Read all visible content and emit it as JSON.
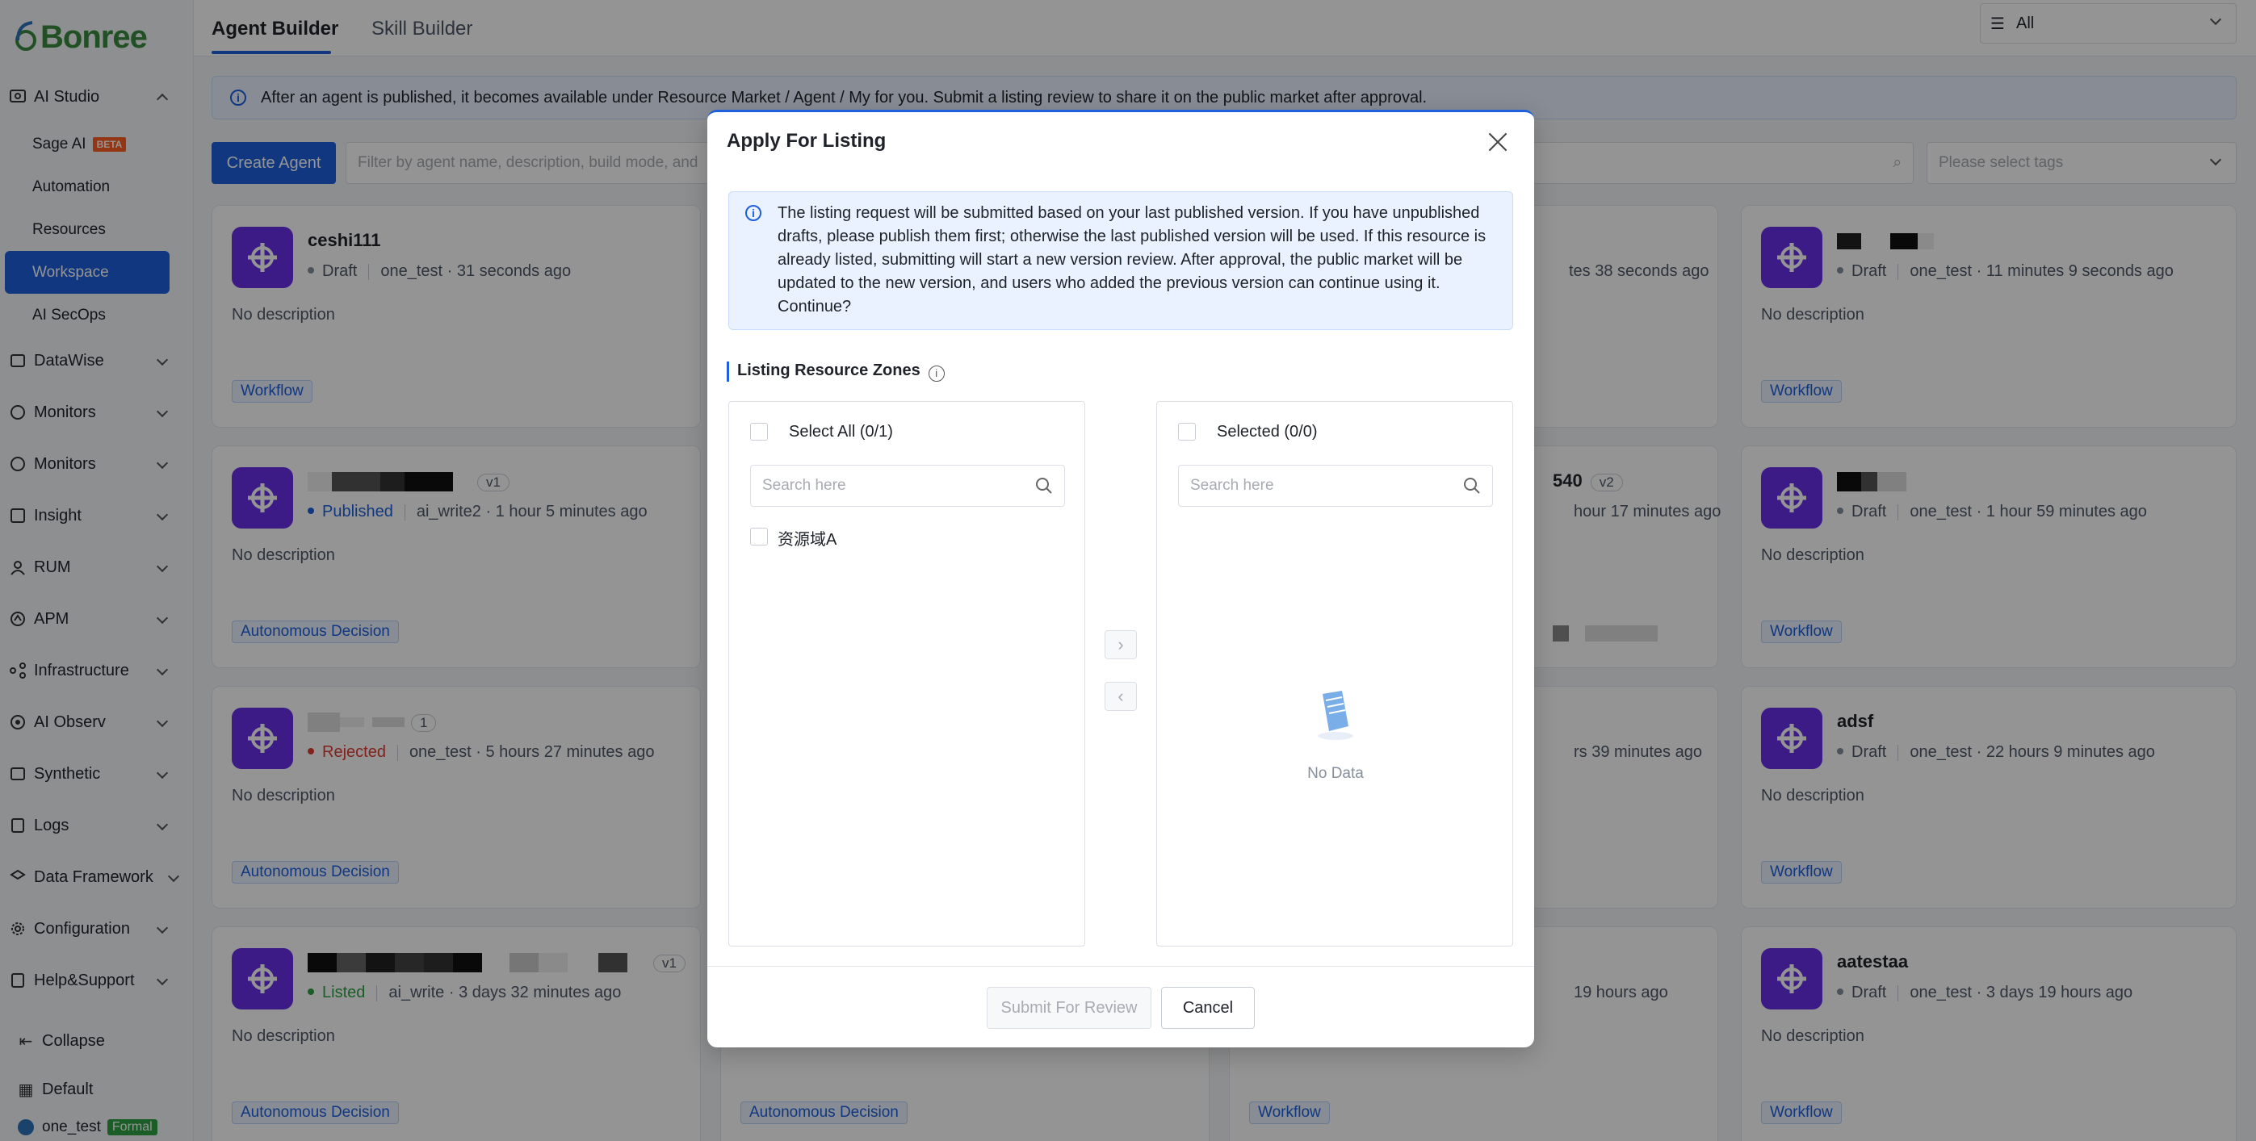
{
  "brand": {
    "name": "Bonree",
    "color": "#3a8a3e"
  },
  "sidebar": {
    "ai_studio": "AI Studio",
    "sub_items": [
      {
        "label": "Sage AI",
        "badge": "BETA"
      },
      {
        "label": "Automation"
      },
      {
        "label": "Resources"
      },
      {
        "label": "Workspace",
        "active": true
      },
      {
        "label": "AI SecOps"
      }
    ],
    "groups": [
      "DataWise",
      "Monitors",
      "Monitors",
      "Insight",
      "RUM",
      "APM",
      "Infrastructure",
      "AI Observ",
      "Synthetic",
      "Logs",
      "Data Framework",
      "Configuration",
      "Help&Support"
    ],
    "collapse": "Collapse",
    "default": "Default",
    "user": {
      "name": "one_test",
      "badge": "Formal"
    }
  },
  "tabs": {
    "agent_builder": "Agent Builder",
    "skill_builder": "Skill Builder"
  },
  "top_select": {
    "value": "All"
  },
  "banner": "After an agent is published, it becomes available under Resource Market / Agent / My for you. Submit a listing review to share it on the public market after approval.",
  "toolbar": {
    "create_label": "Create Agent",
    "filter_placeholder": "Filter by agent name, description, build mode, and",
    "tags_placeholder": "Please select tags"
  },
  "cards": {
    "c1": {
      "name": "ceshi111",
      "status": "Draft",
      "owner": "one_test",
      "time": "31 seconds ago",
      "desc": "No description",
      "tag": "Workflow"
    },
    "c2": {
      "version": "v1",
      "status": "Published",
      "owner": "ai_write2",
      "time": "1 hour 5 minutes ago",
      "desc": "No description",
      "tag": "Autonomous Decision"
    },
    "c3": {
      "version": "1",
      "status": "Rejected",
      "owner": "one_test",
      "time": "5 hours 27 minutes ago",
      "desc": "No description",
      "tag": "Autonomous Decision"
    },
    "c4": {
      "version": "v1",
      "status": "Listed",
      "owner": "ai_write",
      "time": "3 days 32 minutes ago",
      "desc": "No description",
      "tag": "Autonomous Decision"
    },
    "c5": {
      "tag": "Autonomous Decision"
    },
    "c6": {
      "time_partial": "tes 38 seconds ago"
    },
    "c7": {
      "name_partial": "540",
      "version": "v2",
      "time_partial": "hour 17 minutes ago"
    },
    "c8": {
      "time_partial": "rs 39 minutes ago"
    },
    "c9": {
      "time_partial": "19 hours ago",
      "tag": "Workflow"
    },
    "c10": {
      "status": "Draft",
      "owner": "one_test",
      "time": "11 minutes 9 seconds ago",
      "desc": "No description",
      "tag": "Workflow"
    },
    "c11": {
      "status": "Draft",
      "owner": "one_test",
      "time": "1 hour 59 minutes ago",
      "desc": "No description",
      "tag": "Workflow"
    },
    "c12": {
      "name": "adsf",
      "status": "Draft",
      "owner": "one_test",
      "time": "22 hours 9 minutes ago",
      "desc": "No description",
      "tag": "Workflow"
    },
    "c13": {
      "name": "aatestaa",
      "status": "Draft",
      "owner": "one_test",
      "time": "3 days 19 hours ago",
      "desc": "No description",
      "tag": "Workflow"
    }
  },
  "modal": {
    "title": "Apply For Listing",
    "notice": "The listing request will be submitted based on your last published version. If you have unpublished drafts, please publish them first; otherwise the last published version will be used. If this resource is already listed, submitting will start a new version review. After approval, the public market will be updated to the new version, and users who added the previous version can continue using it. Continue?",
    "section_title": "Listing Resource Zones",
    "left": {
      "header": "Select All (0/1)",
      "search_placeholder": "Search here",
      "items": [
        "资源域A"
      ]
    },
    "right": {
      "header": "Selected (0/0)",
      "search_placeholder": "Search here",
      "empty": "No Data"
    },
    "submit_label": "Submit For Review",
    "cancel_label": "Cancel"
  },
  "colors": {
    "primary": "#1d5fdc",
    "agent_avatar": "#6a30e8",
    "published": "#1d5fdc",
    "rejected": "#e03c31",
    "listed": "#2ea043",
    "draft": "#86909c"
  }
}
